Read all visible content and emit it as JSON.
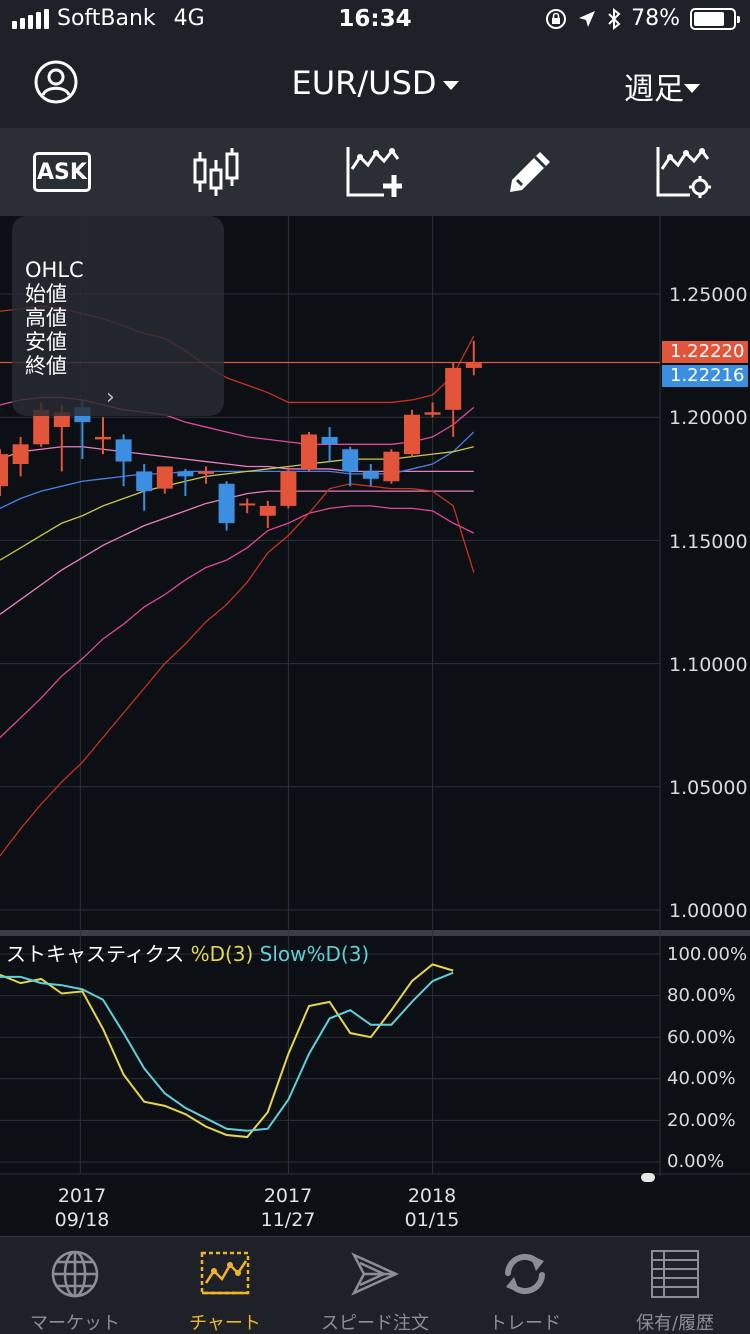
{
  "status_bar": {
    "carrier": "SoftBank",
    "network": "4G",
    "time": "16:34",
    "battery": "78%",
    "battery_level": 0.78
  },
  "header": {
    "title": "EUR/USD",
    "period": "週足"
  },
  "toolbar": {
    "ask_label": "ASK"
  },
  "ohlc_panel": {
    "lines": [
      "OHLC",
      "始値",
      "高値",
      "安値",
      "終値"
    ]
  },
  "price_axis": {
    "ticks": [
      "1.25000",
      "1.20000",
      "1.15000",
      "1.10000",
      "1.05000",
      "1.00000"
    ],
    "current_ask": "1.22220",
    "current_bid": "1.22216",
    "ask_color": "#e2553a",
    "bid_color": "#3c8fe0"
  },
  "stochastic": {
    "name": "ストキャスティクス",
    "k_label": "%D(3)",
    "slow_label": "Slow%D(3)",
    "ticks": [
      "100.00%",
      "80.00%",
      "60.00%",
      "40.00%",
      "20.00%",
      "0.00%"
    ],
    "k_color": "#e6d64c",
    "slow_color": "#5fd0da"
  },
  "dates": [
    {
      "year": "2017",
      "md": "09/18"
    },
    {
      "year": "2017",
      "md": "11/27"
    },
    {
      "year": "2018",
      "md": "01/15"
    }
  ],
  "tabs": [
    {
      "label": "マーケット",
      "icon": "globe-icon"
    },
    {
      "label": "チャート",
      "icon": "chart-icon"
    },
    {
      "label": "スピード注文",
      "icon": "speed-icon"
    },
    {
      "label": "トレード",
      "icon": "trade-icon"
    },
    {
      "label": "保有/履歴",
      "icon": "list-icon"
    }
  ],
  "chart_data": [
    {
      "type": "candlestick",
      "title": "EUR/USD",
      "ylim": [
        1.0,
        1.25
      ],
      "candles": [
        {
          "o": 1.172,
          "h": 1.187,
          "l": 1.168,
          "c": 1.185
        },
        {
          "o": 1.181,
          "h": 1.192,
          "l": 1.176,
          "c": 1.189
        },
        {
          "o": 1.189,
          "h": 1.206,
          "l": 1.188,
          "c": 1.203
        },
        {
          "o": 1.196,
          "h": 1.205,
          "l": 1.178,
          "c": 1.202
        },
        {
          "o": 1.204,
          "h": 1.207,
          "l": 1.183,
          "c": 1.198
        },
        {
          "o": 1.191,
          "h": 1.2,
          "l": 1.185,
          "c": 1.192
        },
        {
          "o": 1.191,
          "h": 1.193,
          "l": 1.172,
          "c": 1.182
        },
        {
          "o": 1.178,
          "h": 1.181,
          "l": 1.162,
          "c": 1.17
        },
        {
          "o": 1.171,
          "h": 1.18,
          "l": 1.169,
          "c": 1.18
        },
        {
          "o": 1.178,
          "h": 1.179,
          "l": 1.168,
          "c": 1.176
        },
        {
          "o": 1.177,
          "h": 1.18,
          "l": 1.173,
          "c": 1.178
        },
        {
          "o": 1.173,
          "h": 1.174,
          "l": 1.154,
          "c": 1.157
        },
        {
          "o": 1.165,
          "h": 1.167,
          "l": 1.161,
          "c": 1.165
        },
        {
          "o": 1.16,
          "h": 1.166,
          "l": 1.155,
          "c": 1.164
        },
        {
          "o": 1.164,
          "h": 1.18,
          "l": 1.163,
          "c": 1.178
        },
        {
          "o": 1.179,
          "h": 1.194,
          "l": 1.178,
          "c": 1.193
        },
        {
          "o": 1.192,
          "h": 1.196,
          "l": 1.182,
          "c": 1.189
        },
        {
          "o": 1.187,
          "h": 1.188,
          "l": 1.172,
          "c": 1.178
        },
        {
          "o": 1.178,
          "h": 1.181,
          "l": 1.172,
          "c": 1.175
        },
        {
          "o": 1.174,
          "h": 1.187,
          "l": 1.173,
          "c": 1.186
        },
        {
          "o": 1.185,
          "h": 1.203,
          "l": 1.184,
          "c": 1.201
        },
        {
          "o": 1.201,
          "h": 1.206,
          "l": 1.2,
          "c": 1.202
        },
        {
          "o": 1.203,
          "h": 1.222,
          "l": 1.192,
          "c": 1.22
        },
        {
          "o": 1.22,
          "h": 1.231,
          "l": 1.217,
          "c": 1.222
        }
      ],
      "bands": [
        {
          "color": "#c8321e",
          "values": [
            1.243,
            1.244,
            1.245,
            1.244,
            1.242,
            1.24,
            1.237,
            1.234,
            1.232,
            1.227,
            1.221,
            1.216,
            1.213,
            1.21,
            1.206,
            1.206,
            1.206,
            1.206,
            1.206,
            1.206,
            1.207,
            1.209,
            1.217,
            1.233
          ]
        },
        {
          "color": "#e0489a",
          "values": [
            1.205,
            1.207,
            1.208,
            1.208,
            1.207,
            1.205,
            1.203,
            1.202,
            1.201,
            1.198,
            1.196,
            1.194,
            1.192,
            1.191,
            1.19,
            1.189,
            1.189,
            1.189,
            1.189,
            1.189,
            1.19,
            1.192,
            1.197,
            1.204
          ]
        },
        {
          "color": "#e87fc0",
          "values": [
            1.183,
            1.186,
            1.187,
            1.188,
            1.188,
            1.187,
            1.186,
            1.185,
            1.184,
            1.183,
            1.182,
            1.181,
            1.18,
            1.18,
            1.179,
            1.179,
            1.179,
            1.178,
            1.178,
            1.178,
            1.178,
            1.178,
            1.178,
            1.178
          ]
        },
        {
          "color": "#4b7de0",
          "values": [
            1.163,
            1.167,
            1.17,
            1.172,
            1.174,
            1.175,
            1.176,
            1.177,
            1.177,
            1.178,
            1.178,
            1.178,
            1.178,
            1.178,
            1.178,
            1.178,
            1.178,
            1.177,
            1.177,
            1.177,
            1.179,
            1.181,
            1.186,
            1.194
          ]
        },
        {
          "color": "#c7c84a",
          "values": [
            1.142,
            1.147,
            1.152,
            1.157,
            1.16,
            1.164,
            1.167,
            1.17,
            1.172,
            1.174,
            1.176,
            1.177,
            1.178,
            1.179,
            1.18,
            1.181,
            1.182,
            1.183,
            1.183,
            1.183,
            1.184,
            1.185,
            1.186,
            1.188
          ]
        },
        {
          "color": "#e87fc0",
          "values": [
            1.12,
            1.126,
            1.132,
            1.138,
            1.143,
            1.148,
            1.152,
            1.156,
            1.159,
            1.162,
            1.165,
            1.167,
            1.169,
            1.17,
            1.17,
            1.17,
            1.17,
            1.17,
            1.17,
            1.17,
            1.17,
            1.17,
            1.17,
            1.17
          ]
        },
        {
          "color": "#e0489a",
          "values": [
            1.07,
            1.078,
            1.086,
            1.095,
            1.102,
            1.11,
            1.116,
            1.123,
            1.128,
            1.134,
            1.139,
            1.142,
            1.147,
            1.154,
            1.157,
            1.161,
            1.163,
            1.164,
            1.164,
            1.163,
            1.163,
            1.162,
            1.157,
            1.153
          ]
        },
        {
          "color": "#c8321e",
          "values": [
            1.022,
            1.033,
            1.043,
            1.052,
            1.06,
            1.07,
            1.08,
            1.09,
            1.1,
            1.108,
            1.117,
            1.124,
            1.133,
            1.145,
            1.152,
            1.161,
            1.171,
            1.173,
            1.172,
            1.171,
            1.171,
            1.17,
            1.164,
            1.137
          ]
        }
      ]
    },
    {
      "type": "line",
      "title": "ストキャスティクス",
      "ylim": [
        0,
        100
      ],
      "series": [
        {
          "name": "%D(3)",
          "color": "#e6d64c",
          "values": [
            90,
            86,
            88,
            81,
            82,
            64,
            42,
            29,
            27,
            23,
            17,
            13,
            12,
            24,
            52,
            75,
            77,
            62,
            60,
            73,
            87,
            95,
            92
          ]
        },
        {
          "name": "Slow%D(3)",
          "color": "#5fd0da",
          "values": [
            89,
            89,
            86,
            85,
            83,
            78,
            62,
            45,
            33,
            26,
            21,
            16,
            15,
            16,
            30,
            52,
            69,
            73,
            66,
            66,
            77,
            87,
            91
          ]
        }
      ]
    }
  ]
}
